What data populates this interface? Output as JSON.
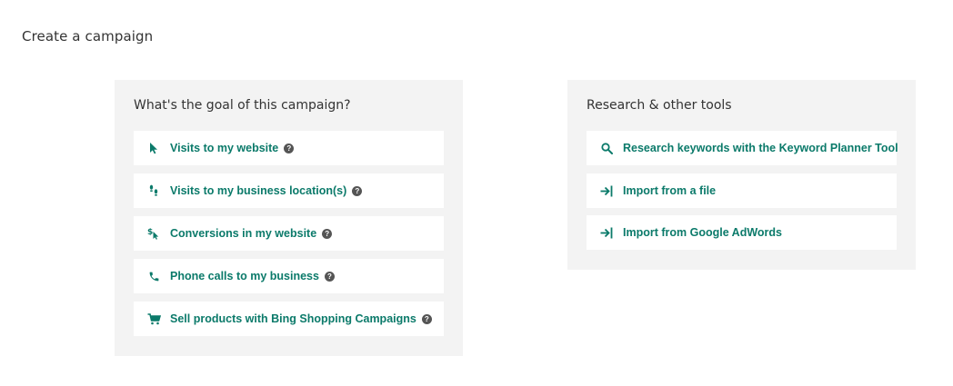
{
  "page": {
    "title": "Create a campaign"
  },
  "goals": {
    "heading": "What's the goal of this campaign?",
    "help_glyph": "?",
    "items": [
      {
        "label": "Visits to my website",
        "icon": "cursor-arrow-icon"
      },
      {
        "label": "Visits to my business location(s)",
        "icon": "footsteps-icon"
      },
      {
        "label": "Conversions in my website",
        "icon": "dollar-cursor-icon"
      },
      {
        "label": "Phone calls to my business",
        "icon": "phone-icon"
      },
      {
        "label": "Sell products with Bing Shopping Campaigns",
        "icon": "shopping-cart-icon"
      }
    ]
  },
  "tools": {
    "heading": "Research & other tools",
    "items": [
      {
        "label": "Research keywords with the Keyword Planner Tool",
        "icon": "search-icon"
      },
      {
        "label": "Import from a file",
        "icon": "import-icon"
      },
      {
        "label": "Import from Google AdWords",
        "icon": "import-icon"
      }
    ]
  },
  "colors": {
    "accent": "#0b7a6a",
    "panel_bg": "#f3f3f3",
    "text": "#333333",
    "help_bg": "#555555"
  }
}
